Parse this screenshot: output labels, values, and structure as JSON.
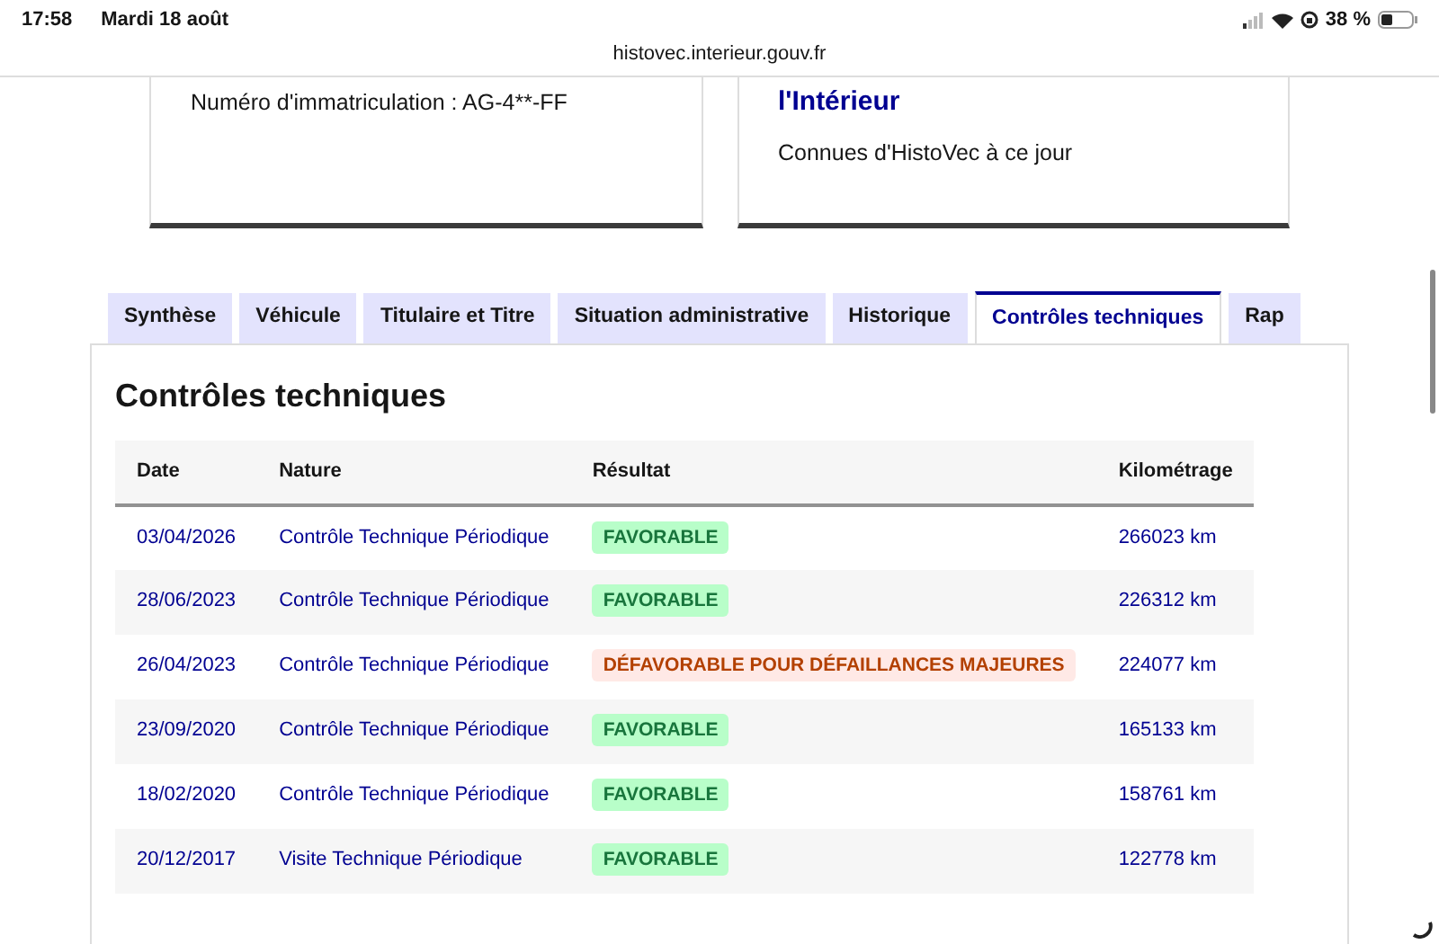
{
  "status_bar": {
    "time": "17:58",
    "date": "Mardi 18 août",
    "battery": "38 %"
  },
  "address_bar": {
    "url": "histovec.interieur.gouv.fr"
  },
  "cards": [
    {
      "text": "Numéro d'immatriculation : AG-4**-FF"
    },
    {
      "title": "l'Intérieur",
      "text": "Connues d'HistoVec à ce jour"
    }
  ],
  "tabs": [
    {
      "label": "Synthèse",
      "selected": false
    },
    {
      "label": "Véhicule",
      "selected": false
    },
    {
      "label": "Titulaire et Titre",
      "selected": false
    },
    {
      "label": "Situation administrative",
      "selected": false
    },
    {
      "label": "Historique",
      "selected": false
    },
    {
      "label": "Contrôles techniques",
      "selected": true
    },
    {
      "label": "Rap",
      "selected": false
    }
  ],
  "section": {
    "title": "Contrôles techniques"
  },
  "table": {
    "columns": [
      "Date",
      "Nature",
      "Résultat",
      "Kilométrage"
    ],
    "rows": [
      {
        "date": "03/04/2026",
        "nature": "Contrôle Technique Périodique",
        "result": {
          "label": "FAVORABLE",
          "kind": "success"
        },
        "km": "266023 km"
      },
      {
        "date": "28/06/2023",
        "nature": "Contrôle Technique Périodique",
        "result": {
          "label": "FAVORABLE",
          "kind": "success"
        },
        "km": "226312 km"
      },
      {
        "date": "26/04/2023",
        "nature": "Contrôle Technique Périodique",
        "result": {
          "label": "DÉFAVORABLE POUR DÉFAILLANCES MAJEURES",
          "kind": "error"
        },
        "km": "224077 km"
      },
      {
        "date": "23/09/2020",
        "nature": "Contrôle Technique Périodique",
        "result": {
          "label": "FAVORABLE",
          "kind": "success"
        },
        "km": "165133 km"
      },
      {
        "date": "18/02/2020",
        "nature": "Contrôle Technique Périodique",
        "result": {
          "label": "FAVORABLE",
          "kind": "success"
        },
        "km": "158761 km"
      },
      {
        "date": "20/12/2017",
        "nature": "Visite Technique Périodique",
        "result": {
          "label": "FAVORABLE",
          "kind": "success"
        },
        "km": "122778 km"
      }
    ]
  }
}
